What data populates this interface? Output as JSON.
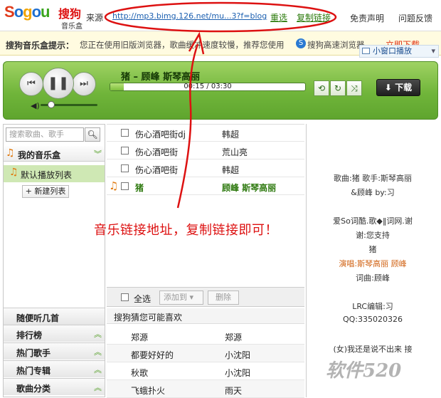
{
  "header": {
    "logo_sogou": "Sogou",
    "logo_cn": "搜狗",
    "logo_sub": "音乐盒",
    "source_label": "来源",
    "url": "http://mp3.bimg.126.net/mu...3?f=blog",
    "retry_label": "重选",
    "copy_label": "复制链接",
    "disclaimer_label": "免责声明",
    "feedback_label": "问题反馈"
  },
  "tip": {
    "title": "搜狗音乐盒提示：",
    "text": "您正在使用旧版浏览器，歌曲缓冲速度较慢，推荐您使用",
    "browser_text": "搜狗高速浏览器。",
    "download_link": "立即下载",
    "mini_label": "小窗口播放"
  },
  "player": {
    "song_title": "猪 – 顾峰  斯琴高丽",
    "time": "00:15 / 03:30",
    "progress": 0.071,
    "volume": 0.12,
    "download_label": "下载",
    "prev_icon": "prev-icon",
    "pause_icon": "pause-icon",
    "next_icon": "next-icon"
  },
  "sidebar": {
    "search_placeholder": "搜索歌曲、歌手",
    "my_box": "我的音乐盒",
    "default_list": "默认播放列表",
    "new_list": "+ 新建列表",
    "sections": [
      "随便听几首",
      "排行榜",
      "热门歌手",
      "热门专辑",
      "歌曲分类"
    ]
  },
  "playlist": {
    "rows": [
      {
        "title": "伤心酒吧街dj",
        "artist": "韩超"
      },
      {
        "title": "伤心酒吧街",
        "artist": "荒山亮"
      },
      {
        "title": "伤心酒吧街",
        "artist": "韩超"
      },
      {
        "title": "猪",
        "artist": "顾峰  斯琴高丽"
      }
    ],
    "select_all": "全选",
    "add_to": "添加到",
    "delete": "删除"
  },
  "recommend": {
    "title": "搜狗猜您可能喜欢",
    "rows": [
      {
        "title": "郑源",
        "artist": "郑源"
      },
      {
        "title": "都要好好的",
        "artist": "小沈阳"
      },
      {
        "title": "秋歌",
        "artist": "小沈阳"
      },
      {
        "title": "飞蛾扑火",
        "artist": "雨天"
      }
    ]
  },
  "lyrics": {
    "lines": [
      "歌曲:猪  歌手:斯琴高丽",
      "&顾峰  by:习",
      "",
      "爱So词酷.歌◆‖词网.谢",
      "谢:您支持",
      "猪",
      "演唱:斯琴高丽 顾峰",
      "词曲:顾峰",
      "",
      "LRC编辑:习",
      "QQ:335020326",
      "",
      "(女)我还是说不出来 接"
    ],
    "highlight_line": "演唱:斯琴高丽 顾峰"
  },
  "annotation": "音乐链接地址，复制链接即可！",
  "watermark": "软件520",
  "colors": {
    "accent_green": "#70b53a",
    "annotation_red": "#d11",
    "link_blue": "#1b5fb0"
  }
}
